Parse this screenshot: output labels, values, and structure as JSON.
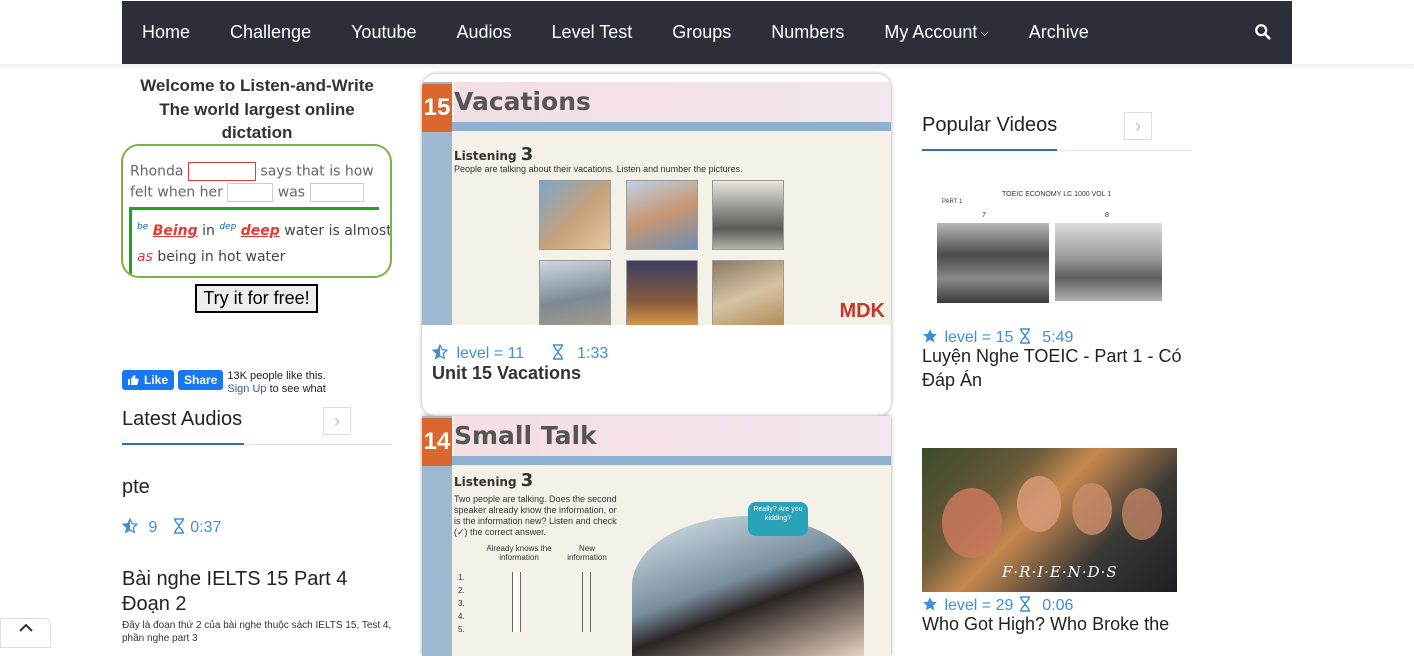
{
  "nav": {
    "items": [
      "Home",
      "Challenge",
      "Youtube",
      "Audios",
      "Level Test",
      "Groups",
      "Numbers",
      "My Account",
      "Archive"
    ],
    "account_chevron": "⌄"
  },
  "welcome": {
    "line1": "Welcome to Listen-and-Write",
    "line2": "The world largest online",
    "line3": "dictation"
  },
  "demo": {
    "w_rhonda": "Rhonda",
    "w_says": "says that is how",
    "w_felt": "felt when her",
    "w_was": "was",
    "sup_be": "be",
    "w_being": "Being",
    "w_in": "in",
    "sup_dep": "dep",
    "w_deep": "deep",
    "w_water": "water is almost",
    "w_as": "as",
    "w_being2": "being in hot water"
  },
  "try_button": "Try it for free!",
  "facebook": {
    "like": "Like",
    "share": "Share",
    "count_text": "13K people like this.",
    "signup": "Sign Up",
    "signup_rest": "to see what"
  },
  "latest_audios": {
    "title": "Latest Audios",
    "items": [
      {
        "title": "pte",
        "level": "9",
        "duration": "0:37"
      },
      {
        "title": "Bài nghe IELTS 15 Part 4 Đoạn 2",
        "desc": "Đây là đoạn thứ 2 của bài nghe thuộc sách IELTS 15, Test 4, phần nghe part 3"
      }
    ]
  },
  "center": {
    "card1": {
      "unit_number": "15",
      "thumb_title": "Vacations",
      "listening_label": "Listening",
      "listening_number": "3",
      "instructions": "People are talking about their vacations. Listen and number the pictures.",
      "brand": "MDK",
      "level_text": "level = 11",
      "duration": "1:33",
      "title": "Unit 15 Vacations"
    },
    "card2": {
      "unit_number": "14",
      "thumb_title": "Small Talk",
      "listening_label": "Listening",
      "listening_number": "3",
      "instructions": "Two people are talking. Does the second speaker already know the information, or is the information new? Listen and check (✓) the correct answer.",
      "col1": "Already knows the information",
      "col2": "New information",
      "bubble": "Really? Are you kidding?"
    }
  },
  "popular": {
    "title": "Popular Videos",
    "items": [
      {
        "level_text": "level = 15",
        "duration": "5:49",
        "title": "Luyện Nghe TOEIC - Part 1 - Có Đáp Án",
        "thumb_caption": "TOEIC ECONOMY LC 1000 VOL 1",
        "thumb_part": "PART 1",
        "num_a": "7",
        "num_b": "8"
      },
      {
        "level_text": "level = 29",
        "duration": "0:06",
        "title": "Who Got High? Who Broke the",
        "thumb_caption": "F·R·I·E·N·D·S"
      }
    ]
  },
  "icons": {
    "search": "search-icon",
    "star": "star-icon",
    "hourglass": "hourglass-icon",
    "arrow_right": "chevron-right-icon",
    "arrow_up": "chevron-up-icon"
  },
  "colors": {
    "navbar": "#2c2f38",
    "accent_blue": "#3d8fd6",
    "underline_blue": "#2f6eb5",
    "demo_border": "#7cb342",
    "facebook": "#1877f2"
  }
}
